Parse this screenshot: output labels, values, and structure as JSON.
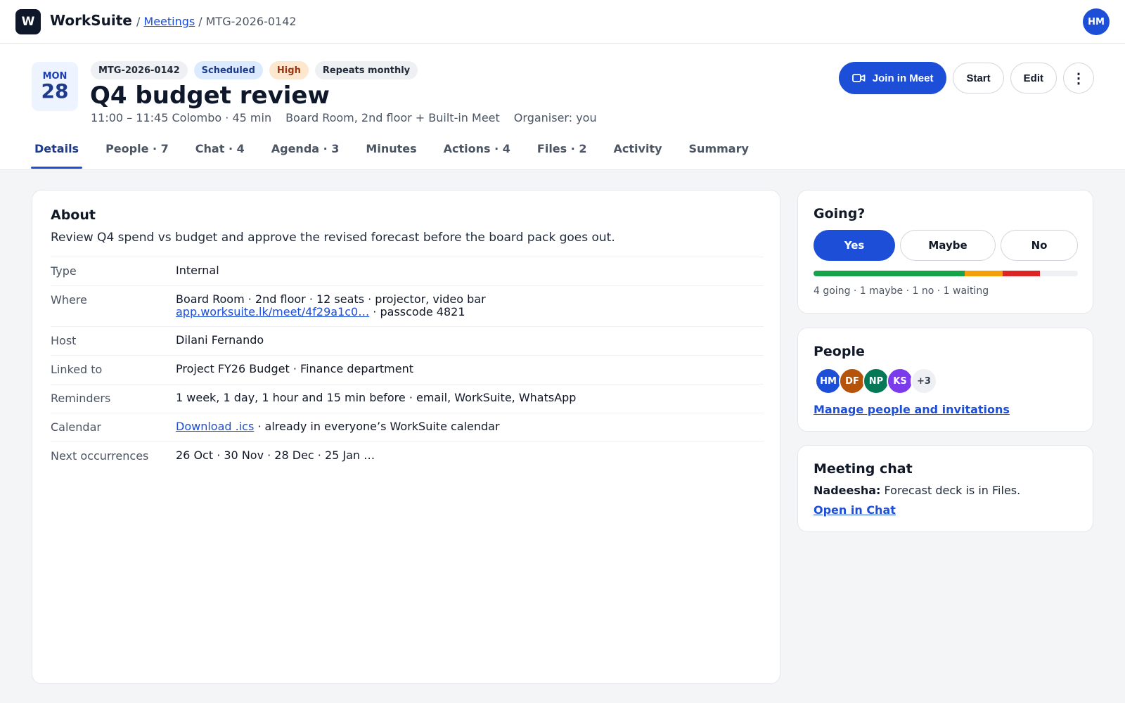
{
  "app": {
    "logo_letter": "W",
    "name": "WorkSuite",
    "user_initials": "HM"
  },
  "breadcrumb": {
    "sep1": "/",
    "meetings": "Meetings",
    "sep2": "/",
    "current": "MTG-2026-0142"
  },
  "meeting": {
    "dow": "MON",
    "day": "28",
    "chips": {
      "id": "MTG-2026-0142",
      "status": "Scheduled",
      "priority": "High",
      "recurrence": "Repeats monthly"
    },
    "title": "Q4 budget review",
    "time": "11:00 – 11:45 Colombo · 45 min",
    "location": "Board Room, 2nd floor + Built-in Meet",
    "organiser": "Organiser: you"
  },
  "actions": {
    "join": "Join in Meet",
    "start": "Start",
    "edit": "Edit",
    "more": "⋮"
  },
  "tabs": [
    "Details",
    "People · 7",
    "Chat · 4",
    "Agenda · 3",
    "Minutes",
    "Actions · 4",
    "Files · 2",
    "Activity",
    "Summary"
  ],
  "about": {
    "title": "About",
    "description": "Review Q4 spend vs budget and approve the revised forecast before the board pack goes out.",
    "type_label": "Type",
    "type_value": "Internal",
    "where_label": "Where",
    "where_line1": "Board Room · 2nd floor · 12 seats · projector, video bar",
    "where_link": "app.worksuite.lk/meet/4f29a1c0…",
    "where_suffix": " · passcode 4821",
    "host_label": "Host",
    "host_value": "Dilani Fernando",
    "linked_label": "Linked to",
    "linked_value": "Project FY26 Budget · Finance department",
    "reminders_label": "Reminders",
    "reminders_value": "1 week, 1 day, 1 hour and 15 min before · email, WorkSuite, WhatsApp",
    "calendar_label": "Calendar",
    "calendar_link": "Download .ics",
    "calendar_suffix": " · already in everyone’s WorkSuite calendar",
    "next_label": "Next occurrences",
    "next_value": "26 Oct · 30 Nov · 28 Dec · 25 Jan …"
  },
  "going": {
    "title": "Going?",
    "yes": "Yes",
    "maybe": "Maybe",
    "no": "No",
    "counts": {
      "going": 4,
      "maybe": 1,
      "no": 1,
      "waiting": 1
    },
    "colors": {
      "going": "#16a34a",
      "maybe": "#f59e0b",
      "no": "#dc2626",
      "waiting": "#eef0f3"
    },
    "summary": "4 going · 1 maybe · 1 no · 1 waiting"
  },
  "people": {
    "title": "People",
    "avatars": [
      {
        "initials": "HM",
        "color": "#1d4ed8"
      },
      {
        "initials": "DF",
        "color": "#b45309"
      },
      {
        "initials": "NP",
        "color": "#047857"
      },
      {
        "initials": "KS",
        "color": "#7c3aed"
      }
    ],
    "more": "+3",
    "manage_link": "Manage people and invitations"
  },
  "chat": {
    "title": "Meeting chat",
    "author": "Nadeesha:",
    "message": " Forecast deck is in Files.",
    "open_link": "Open in Chat"
  }
}
